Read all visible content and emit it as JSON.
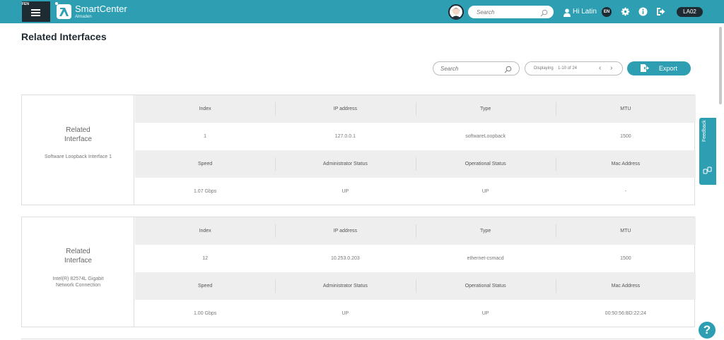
{
  "topbar": {
    "menu_tag": "FEN",
    "brand": "SmartCenter",
    "brand_sub": "Almaden",
    "search_placeholder": "Search",
    "greeting": "Hi Latin",
    "lang": "EN",
    "badge": "LA02",
    "icons": [
      "menu-icon",
      "logo-icon",
      "avatar-icon",
      "search-icon",
      "user-icon",
      "gear-icon",
      "info-icon",
      "logout-icon"
    ]
  },
  "page": {
    "title": "Related Interfaces",
    "search_placeholder": "Search",
    "pager_label": "Displaying",
    "pager_range": "1-10 of 24",
    "export_label": "Export"
  },
  "headers_top": [
    "Index",
    "IP address",
    "Type",
    "MTU"
  ],
  "headers_bottom": [
    "Speed",
    "Administrator Status",
    "Operational Status",
    "Mac Address"
  ],
  "interfaces": [
    {
      "title_line1": "Related",
      "title_line2": "Interface",
      "subtitle": "Software Loopback Interface 1",
      "index": "1",
      "ip": "127.0.0.1",
      "type": "softwareLoopback",
      "mtu": "1500",
      "speed": "1.07 Gbps",
      "admin": "UP",
      "oper": "UP",
      "mac": "-"
    },
    {
      "title_line1": "Related",
      "title_line2": "Interface",
      "subtitle": "Intel(R) 82574L Gigabit Network Connection",
      "index": "12",
      "ip": "10.253.0.203",
      "type": "ethernet-csmacd",
      "mtu": "1500",
      "speed": "1.00 Gbps",
      "admin": "UP",
      "oper": "UP",
      "mac": "00:50:56:BD:22:24"
    }
  ],
  "feedback_label": "Feedback",
  "help_label": "?",
  "colors": {
    "accent": "#2e9fb3",
    "dark": "#1f2b33"
  }
}
